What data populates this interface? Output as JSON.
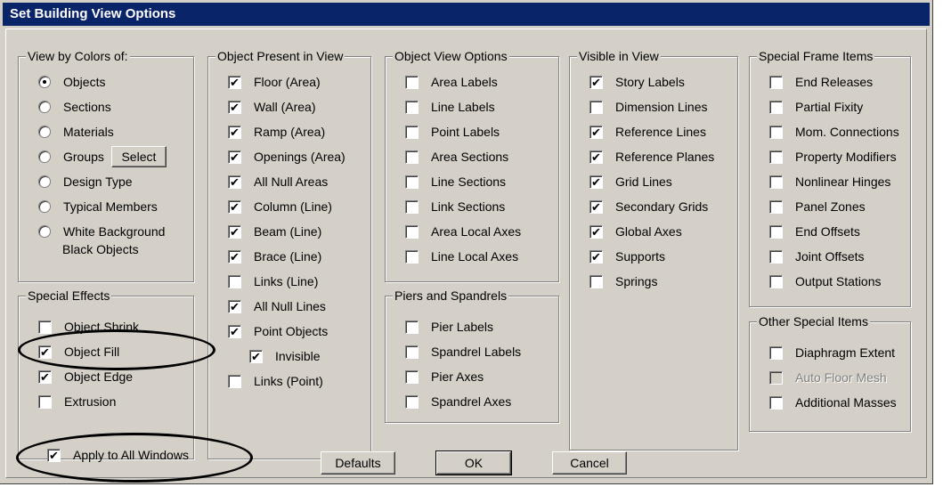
{
  "window": {
    "title": "Set Building View Options"
  },
  "groups": {
    "view_by_colors": {
      "title": "View by Colors of:",
      "options": [
        {
          "label": "Objects",
          "selected": true
        },
        {
          "label": "Sections",
          "selected": false
        },
        {
          "label": "Materials",
          "selected": false
        },
        {
          "label": "Groups",
          "selected": false
        },
        {
          "label": "Design Type",
          "selected": false
        },
        {
          "label": "Typical Members",
          "selected": false
        },
        {
          "label": "White Background",
          "selected": false
        }
      ],
      "white_bg_line2": "Black Objects",
      "select_button": "Select"
    },
    "special_effects": {
      "title": "Special Effects",
      "items": [
        {
          "label": "Object Shrink",
          "checked": false
        },
        {
          "label": "Object Fill",
          "checked": true
        },
        {
          "label": "Object Edge",
          "checked": true
        },
        {
          "label": "Extrusion",
          "checked": false
        }
      ]
    },
    "object_present": {
      "title": "Object Present in View",
      "items": [
        {
          "label": "Floor (Area)",
          "checked": true
        },
        {
          "label": "Wall (Area)",
          "checked": true
        },
        {
          "label": "Ramp (Area)",
          "checked": true
        },
        {
          "label": "Openings (Area)",
          "checked": true
        },
        {
          "label": "All Null Areas",
          "checked": true
        },
        {
          "label": "Column (Line)",
          "checked": true
        },
        {
          "label": "Beam (Line)",
          "checked": true
        },
        {
          "label": "Brace (Line)",
          "checked": true
        },
        {
          "label": "Links (Line)",
          "checked": false
        },
        {
          "label": "All Null Lines",
          "checked": true
        },
        {
          "label": "Point Objects",
          "checked": true
        },
        {
          "label": "Invisible",
          "checked": true
        },
        {
          "label": "Links (Point)",
          "checked": false
        }
      ]
    },
    "object_view_options": {
      "title": "Object View Options",
      "items": [
        {
          "label": "Area Labels",
          "checked": false
        },
        {
          "label": "Line Labels",
          "checked": false
        },
        {
          "label": "Point Labels",
          "checked": false
        },
        {
          "label": "Area Sections",
          "checked": false
        },
        {
          "label": "Line Sections",
          "checked": false
        },
        {
          "label": "Link Sections",
          "checked": false
        },
        {
          "label": "Area Local Axes",
          "checked": false
        },
        {
          "label": "Line Local Axes",
          "checked": false
        }
      ]
    },
    "piers_spandrels": {
      "title": "Piers and Spandrels",
      "items": [
        {
          "label": "Pier Labels",
          "checked": false
        },
        {
          "label": "Spandrel Labels",
          "checked": false
        },
        {
          "label": "Pier Axes",
          "checked": false
        },
        {
          "label": "Spandrel Axes",
          "checked": false
        }
      ]
    },
    "visible_in_view": {
      "title": "Visible in View",
      "items": [
        {
          "label": "Story Labels",
          "checked": true
        },
        {
          "label": "Dimension Lines",
          "checked": false
        },
        {
          "label": "Reference Lines",
          "checked": true
        },
        {
          "label": "Reference Planes",
          "checked": true
        },
        {
          "label": "Grid Lines",
          "checked": true
        },
        {
          "label": "Secondary Grids",
          "checked": true
        },
        {
          "label": "Global Axes",
          "checked": true
        },
        {
          "label": "Supports",
          "checked": true
        },
        {
          "label": "Springs",
          "checked": false
        }
      ]
    },
    "special_frame_items": {
      "title": "Special Frame Items",
      "items": [
        {
          "label": "End Releases",
          "checked": false
        },
        {
          "label": "Partial Fixity",
          "checked": false
        },
        {
          "label": "Mom. Connections",
          "checked": false
        },
        {
          "label": "Property Modifiers",
          "checked": false
        },
        {
          "label": "Nonlinear Hinges",
          "checked": false
        },
        {
          "label": "Panel Zones",
          "checked": false
        },
        {
          "label": "End Offsets",
          "checked": false
        },
        {
          "label": "Joint Offsets",
          "checked": false
        },
        {
          "label": "Output Stations",
          "checked": false
        }
      ]
    },
    "other_special_items": {
      "title": "Other Special Items",
      "items": [
        {
          "label": "Diaphragm Extent",
          "checked": false,
          "disabled": false
        },
        {
          "label": "Auto Floor Mesh",
          "checked": false,
          "disabled": true
        },
        {
          "label": "Additional Masses",
          "checked": false,
          "disabled": false
        }
      ]
    }
  },
  "apply_all": {
    "label": "Apply to All Windows",
    "checked": true
  },
  "buttons": {
    "defaults": "Defaults",
    "ok": "OK",
    "cancel": "Cancel"
  }
}
